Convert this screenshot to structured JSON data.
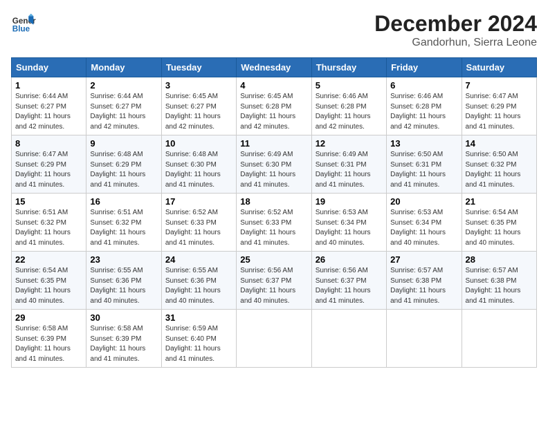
{
  "logo": {
    "line1": "General",
    "line2": "Blue"
  },
  "title": "December 2024",
  "location": "Gandorhun, Sierra Leone",
  "days_of_week": [
    "Sunday",
    "Monday",
    "Tuesday",
    "Wednesday",
    "Thursday",
    "Friday",
    "Saturday"
  ],
  "weeks": [
    [
      {
        "day": "1",
        "sunrise": "6:44 AM",
        "sunset": "6:27 PM",
        "daylight": "11 hours and 42 minutes."
      },
      {
        "day": "2",
        "sunrise": "6:44 AM",
        "sunset": "6:27 PM",
        "daylight": "11 hours and 42 minutes."
      },
      {
        "day": "3",
        "sunrise": "6:45 AM",
        "sunset": "6:27 PM",
        "daylight": "11 hours and 42 minutes."
      },
      {
        "day": "4",
        "sunrise": "6:45 AM",
        "sunset": "6:28 PM",
        "daylight": "11 hours and 42 minutes."
      },
      {
        "day": "5",
        "sunrise": "6:46 AM",
        "sunset": "6:28 PM",
        "daylight": "11 hours and 42 minutes."
      },
      {
        "day": "6",
        "sunrise": "6:46 AM",
        "sunset": "6:28 PM",
        "daylight": "11 hours and 42 minutes."
      },
      {
        "day": "7",
        "sunrise": "6:47 AM",
        "sunset": "6:29 PM",
        "daylight": "11 hours and 41 minutes."
      }
    ],
    [
      {
        "day": "8",
        "sunrise": "6:47 AM",
        "sunset": "6:29 PM",
        "daylight": "11 hours and 41 minutes."
      },
      {
        "day": "9",
        "sunrise": "6:48 AM",
        "sunset": "6:29 PM",
        "daylight": "11 hours and 41 minutes."
      },
      {
        "day": "10",
        "sunrise": "6:48 AM",
        "sunset": "6:30 PM",
        "daylight": "11 hours and 41 minutes."
      },
      {
        "day": "11",
        "sunrise": "6:49 AM",
        "sunset": "6:30 PM",
        "daylight": "11 hours and 41 minutes."
      },
      {
        "day": "12",
        "sunrise": "6:49 AM",
        "sunset": "6:31 PM",
        "daylight": "11 hours and 41 minutes."
      },
      {
        "day": "13",
        "sunrise": "6:50 AM",
        "sunset": "6:31 PM",
        "daylight": "11 hours and 41 minutes."
      },
      {
        "day": "14",
        "sunrise": "6:50 AM",
        "sunset": "6:32 PM",
        "daylight": "11 hours and 41 minutes."
      }
    ],
    [
      {
        "day": "15",
        "sunrise": "6:51 AM",
        "sunset": "6:32 PM",
        "daylight": "11 hours and 41 minutes."
      },
      {
        "day": "16",
        "sunrise": "6:51 AM",
        "sunset": "6:32 PM",
        "daylight": "11 hours and 41 minutes."
      },
      {
        "day": "17",
        "sunrise": "6:52 AM",
        "sunset": "6:33 PM",
        "daylight": "11 hours and 41 minutes."
      },
      {
        "day": "18",
        "sunrise": "6:52 AM",
        "sunset": "6:33 PM",
        "daylight": "11 hours and 41 minutes."
      },
      {
        "day": "19",
        "sunrise": "6:53 AM",
        "sunset": "6:34 PM",
        "daylight": "11 hours and 40 minutes."
      },
      {
        "day": "20",
        "sunrise": "6:53 AM",
        "sunset": "6:34 PM",
        "daylight": "11 hours and 40 minutes."
      },
      {
        "day": "21",
        "sunrise": "6:54 AM",
        "sunset": "6:35 PM",
        "daylight": "11 hours and 40 minutes."
      }
    ],
    [
      {
        "day": "22",
        "sunrise": "6:54 AM",
        "sunset": "6:35 PM",
        "daylight": "11 hours and 40 minutes."
      },
      {
        "day": "23",
        "sunrise": "6:55 AM",
        "sunset": "6:36 PM",
        "daylight": "11 hours and 40 minutes."
      },
      {
        "day": "24",
        "sunrise": "6:55 AM",
        "sunset": "6:36 PM",
        "daylight": "11 hours and 40 minutes."
      },
      {
        "day": "25",
        "sunrise": "6:56 AM",
        "sunset": "6:37 PM",
        "daylight": "11 hours and 40 minutes."
      },
      {
        "day": "26",
        "sunrise": "6:56 AM",
        "sunset": "6:37 PM",
        "daylight": "11 hours and 41 minutes."
      },
      {
        "day": "27",
        "sunrise": "6:57 AM",
        "sunset": "6:38 PM",
        "daylight": "11 hours and 41 minutes."
      },
      {
        "day": "28",
        "sunrise": "6:57 AM",
        "sunset": "6:38 PM",
        "daylight": "11 hours and 41 minutes."
      }
    ],
    [
      {
        "day": "29",
        "sunrise": "6:58 AM",
        "sunset": "6:39 PM",
        "daylight": "11 hours and 41 minutes."
      },
      {
        "day": "30",
        "sunrise": "6:58 AM",
        "sunset": "6:39 PM",
        "daylight": "11 hours and 41 minutes."
      },
      {
        "day": "31",
        "sunrise": "6:59 AM",
        "sunset": "6:40 PM",
        "daylight": "11 hours and 41 minutes."
      },
      null,
      null,
      null,
      null
    ]
  ]
}
